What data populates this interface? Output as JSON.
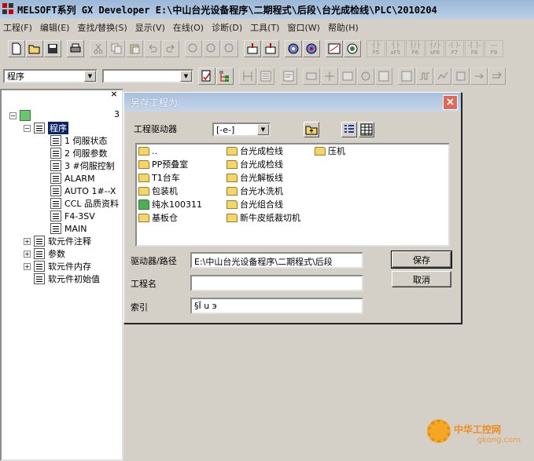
{
  "window": {
    "title": "MELSOFT系列 GX Developer E:\\中山台光设备程序\\二期程式\\后段\\台光成检线\\PLC\\2010204"
  },
  "menu": [
    "工程(F)",
    "编辑(E)",
    "查找/替换(S)",
    "显示(V)",
    "在线(O)",
    "诊断(D)",
    "工具(T)",
    "窗口(W)",
    "帮助(H)"
  ],
  "toolbar": {
    "fkeys": [
      {
        "sym": "┤├",
        "key": "F5"
      },
      {
        "sym": "┤├",
        "key": "sF5"
      },
      {
        "sym": "┤/├",
        "key": "F6"
      },
      {
        "sym": "┤/├",
        "key": "sF6"
      },
      {
        "sym": "-( )-",
        "key": "F7"
      },
      {
        "sym": "-[ ]-",
        "key": "F8"
      },
      {
        "sym": "—",
        "key": "F9"
      }
    ],
    "mode_combo": "程序",
    "block_combo": ""
  },
  "tree": {
    "close": "×",
    "root_marker": "3",
    "items": [
      {
        "label": "程序",
        "selected": true
      },
      {
        "label": "1 伺服状态"
      },
      {
        "label": "2 伺服参数"
      },
      {
        "label": "3 #伺服控制"
      },
      {
        "label": "ALARM"
      },
      {
        "label": "AUTO 1#--X"
      },
      {
        "label": "CCL 品质资料"
      },
      {
        "label": "F4-3SV"
      },
      {
        "label": "MAIN"
      },
      {
        "label": "软元件注释"
      },
      {
        "label": "参数"
      },
      {
        "label": "软元件内存"
      },
      {
        "label": "软元件初始值"
      }
    ]
  },
  "dialog": {
    "title": "另存工程为",
    "close": "×",
    "drive_label": "工程驱动器",
    "drive_value": "[-e-]",
    "files": [
      {
        "name": "..",
        "type": "folder"
      },
      {
        "name": "PP预叠室",
        "type": "folder"
      },
      {
        "name": "T1台车",
        "type": "folder"
      },
      {
        "name": "包装机",
        "type": "folder"
      },
      {
        "name": "纯水100311",
        "type": "project"
      },
      {
        "name": "基板仓",
        "type": "folder"
      },
      {
        "name": "台光成检线",
        "type": "folder"
      },
      {
        "name": "台光成检线",
        "type": "folder"
      },
      {
        "name": "台光解板线",
        "type": "folder"
      },
      {
        "name": "台光水洗机",
        "type": "folder"
      },
      {
        "name": "台光组合线",
        "type": "folder"
      },
      {
        "name": "新牛皮纸裁切机",
        "type": "folder"
      },
      {
        "name": "压机",
        "type": "folder"
      }
    ],
    "path_label": "驱动器/路径",
    "path_value": "E:\\中山台光设备程序\\二期程式\\后段",
    "name_label": "工程名",
    "name_value": "",
    "index_label": "索引",
    "index_value": "§Ï u   э",
    "save_button": "保存",
    "cancel_button": "取消"
  },
  "watermark": {
    "brand": "中华工控网",
    "url": "gkong.com"
  }
}
